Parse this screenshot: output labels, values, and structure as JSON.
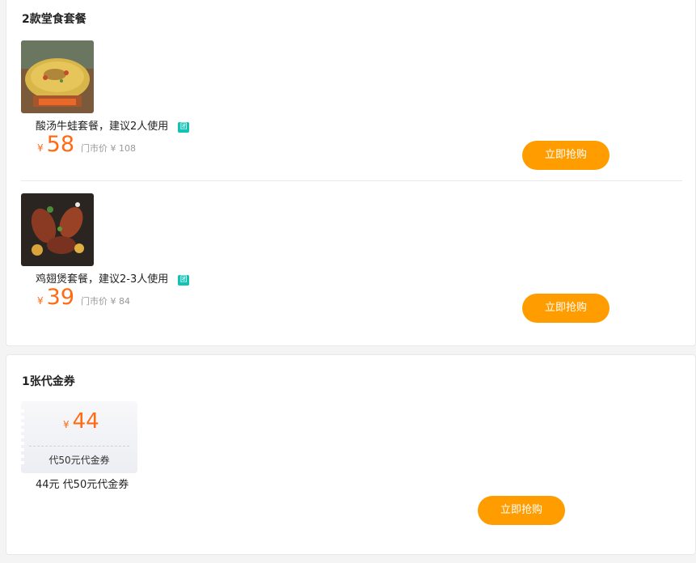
{
  "dine_in": {
    "title": "2款堂食套餐",
    "deals": [
      {
        "name": "酸汤牛蛙套餐，建议2人使用",
        "badge": "团",
        "currency": "¥",
        "price": "58",
        "orig_price": "门市价 ¥ 108",
        "button": "立即抢购",
        "image_icon": "hotpot-photo"
      },
      {
        "name": "鸡翅煲套餐，建议2-3人使用",
        "badge": "团",
        "currency": "¥",
        "price": "39",
        "orig_price": "门市价 ¥ 84",
        "button": "立即抢购",
        "image_icon": "chicken-wings-photo"
      }
    ]
  },
  "vouchers": {
    "title": "1张代金券",
    "coupon": {
      "currency": "¥",
      "price": "44",
      "label": "代50元代金券"
    },
    "caption": "44元 代50元代金券",
    "button": "立即抢购"
  },
  "colors": {
    "price": "#ff6a13",
    "button": "#ff9d00",
    "badge": "#13c2b4"
  }
}
